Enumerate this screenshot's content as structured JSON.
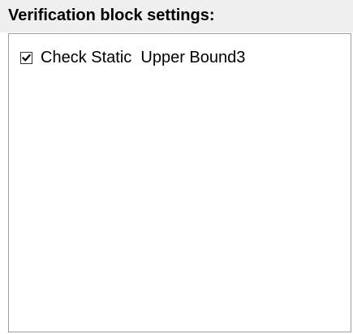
{
  "panel": {
    "title": "Verification block settings:"
  },
  "settings_list": {
    "items": [
      {
        "label": "Check Static  Upper Bound3",
        "checked": true
      }
    ]
  },
  "colors": {
    "header_background": "#efefef",
    "list_border": "#a0a0a0",
    "text": "#000000"
  }
}
